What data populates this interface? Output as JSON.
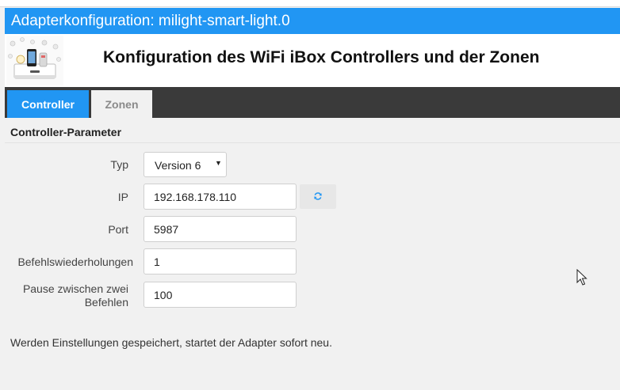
{
  "window": {
    "title": "Adapterkonfiguration: milight-smart-light.0"
  },
  "header": {
    "logo_icon": "wifi-ibox-controller-image",
    "title": "Konfiguration des WiFi iBox Controllers und der Zonen"
  },
  "tabs": [
    {
      "label": "Controller",
      "active": true
    },
    {
      "label": "Zonen",
      "active": false
    }
  ],
  "section": {
    "title": "Controller-Parameter"
  },
  "form": {
    "typ": {
      "label": "Typ",
      "value": "Version 6"
    },
    "ip": {
      "label": "IP",
      "value": "192.168.178.110",
      "refresh_icon": "refresh-icon"
    },
    "port": {
      "label": "Port",
      "value": "5987"
    },
    "repeats": {
      "label": "Befehlswiederholungen",
      "value": "1"
    },
    "pause": {
      "label_line1": "Pause zwischen zwei",
      "label_line2": "Befehlen",
      "value": "100"
    }
  },
  "note": "Werden Einstellungen gespeichert, startet der Adapter sofort neu.",
  "colors": {
    "accent": "#2196f3",
    "tabbar": "#3a3a3a",
    "background": "#f1f1f1"
  }
}
